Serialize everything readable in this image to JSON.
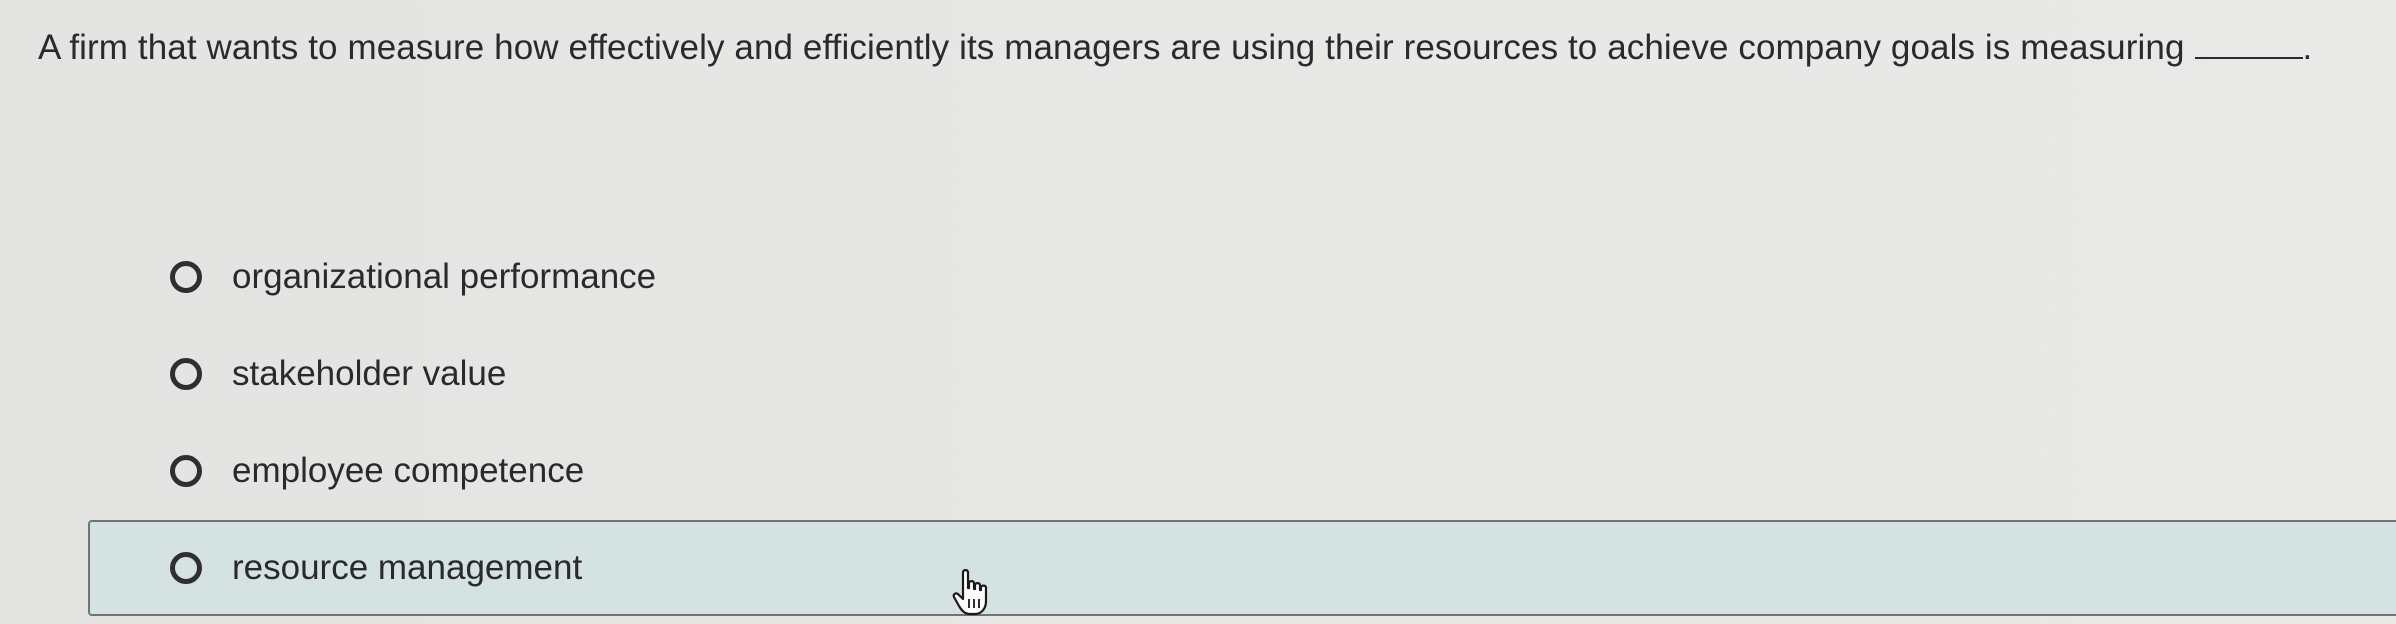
{
  "question": {
    "text": "A firm that wants to measure how effectively and efficiently its managers are using their resources to achieve company goals is measuring",
    "blank_suffix": "."
  },
  "options": [
    {
      "label": "organizational performance",
      "selected": false
    },
    {
      "label": "stakeholder value",
      "selected": false
    },
    {
      "label": "employee competence",
      "selected": false
    },
    {
      "label": "resource management",
      "selected": false,
      "hovered": true
    }
  ],
  "colors": {
    "background": "#e6e6e4",
    "text": "#2a2a2a",
    "hover_background": "#d4e3e1",
    "hover_border": "#6f7472"
  },
  "icons": {
    "radio": "radio-unchecked-icon",
    "cursor": "hand-pointer-icon"
  }
}
